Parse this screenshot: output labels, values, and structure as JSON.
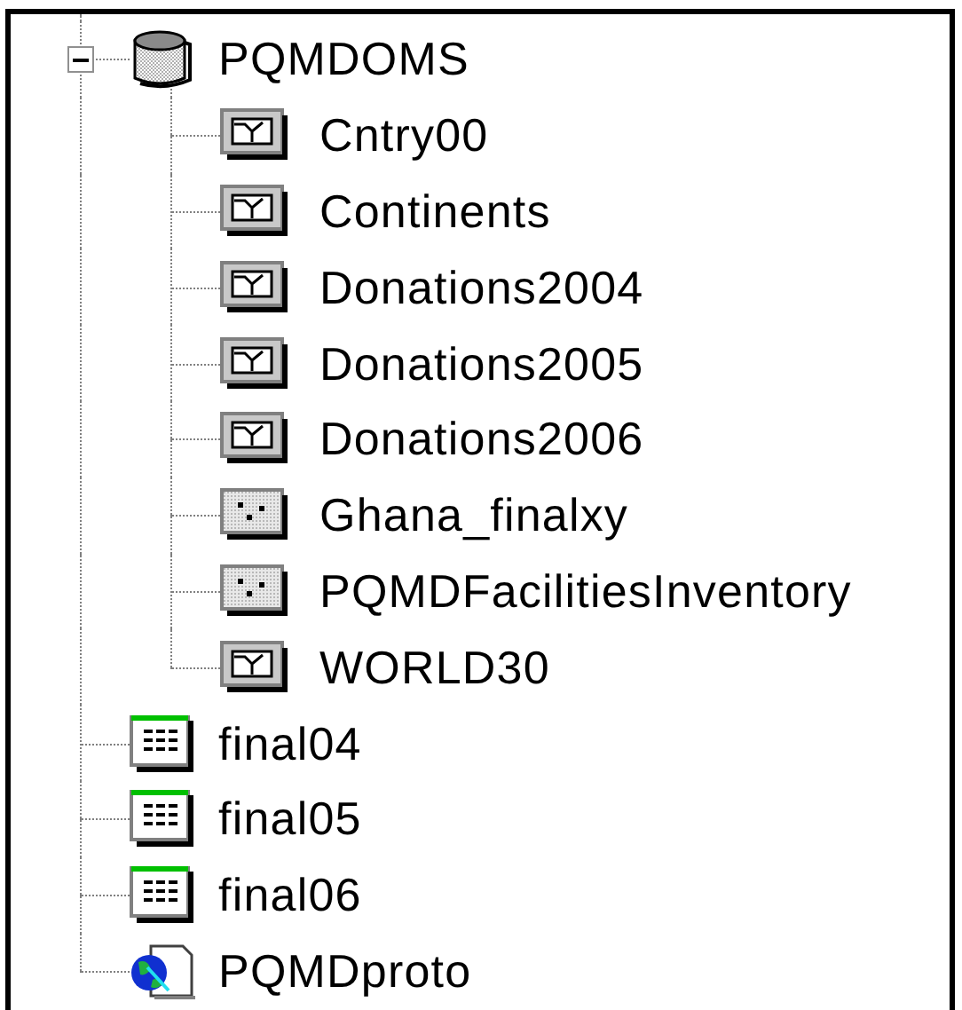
{
  "tree": [
    {
      "label": "PQMDOMS",
      "kind": "database",
      "expanded": true,
      "children": [
        {
          "label": "Cntry00",
          "kind": "line_feature"
        },
        {
          "label": "Continents",
          "kind": "line_feature"
        },
        {
          "label": "Donations2004",
          "kind": "line_feature"
        },
        {
          "label": "Donations2005",
          "kind": "line_feature"
        },
        {
          "label": "Donations2006",
          "kind": "line_feature"
        },
        {
          "label": "Ghana_finalxy",
          "kind": "point_feature"
        },
        {
          "label": "PQMDFacilitiesInventory",
          "kind": "point_feature"
        },
        {
          "label": "WORLD30",
          "kind": "line_feature"
        }
      ]
    },
    {
      "label": "final04",
      "kind": "table"
    },
    {
      "label": "final05",
      "kind": "table"
    },
    {
      "label": "final06",
      "kind": "table"
    },
    {
      "label": "PQMDproto",
      "kind": "map_document"
    }
  ]
}
